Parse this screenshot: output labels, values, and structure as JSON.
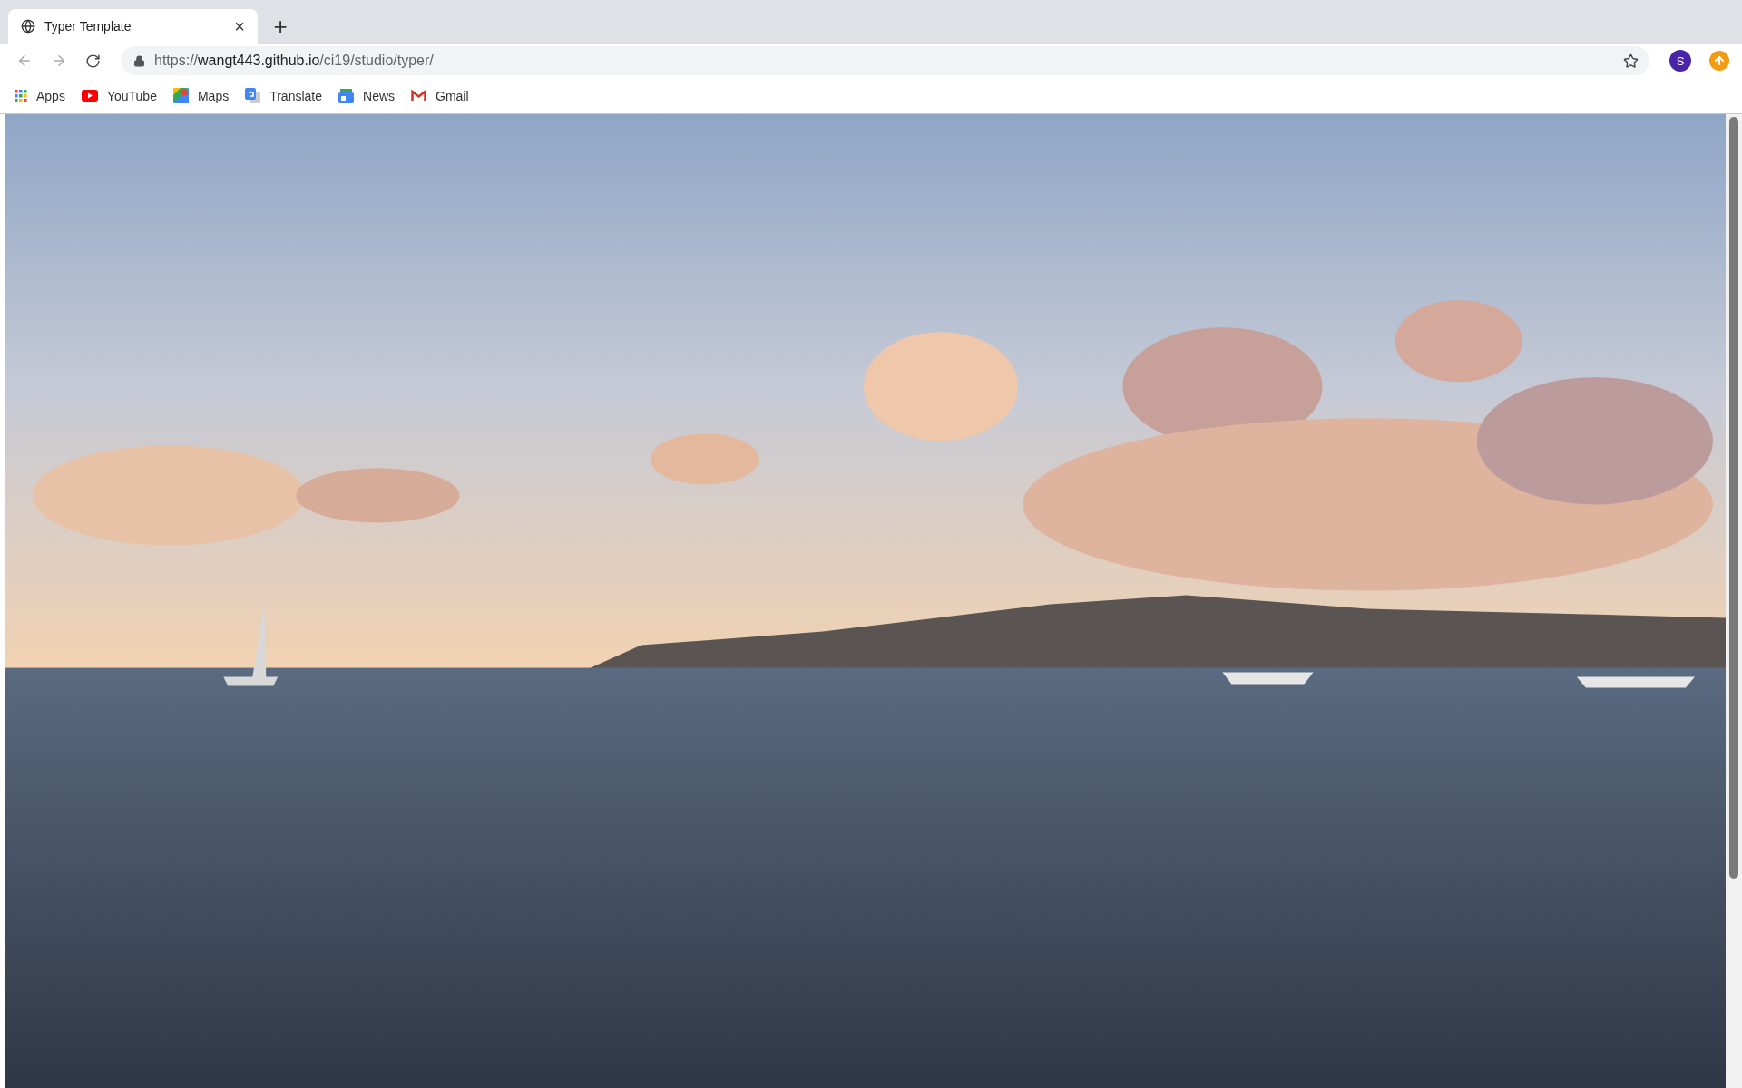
{
  "tabs": [
    {
      "title": "Typer Template",
      "close": "×",
      "selected": true
    }
  ],
  "new_tab": "+",
  "address_bar": {
    "scheme": "https://",
    "host": "wangt443.github.io",
    "path": "/ci19/studio/typer/"
  },
  "profile": {
    "initial": "S"
  },
  "bookmarks": [
    {
      "label": "Apps",
      "kind": "apps"
    },
    {
      "label": "YouTube",
      "kind": "youtube"
    },
    {
      "label": "Maps",
      "kind": "maps"
    },
    {
      "label": "Translate",
      "kind": "translate"
    },
    {
      "label": "News",
      "kind": "news"
    },
    {
      "label": "Gmail",
      "kind": "gmail"
    }
  ]
}
